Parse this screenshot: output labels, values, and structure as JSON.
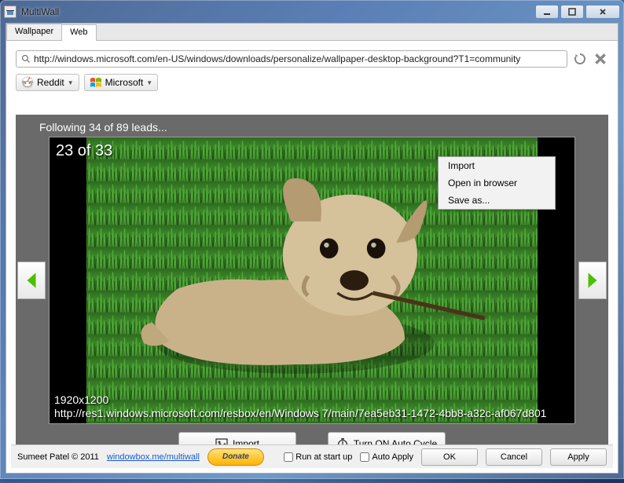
{
  "app_title": "MultiWall",
  "tabs": {
    "wallpaper": "Wallpaper",
    "web": "Web"
  },
  "url": "http://windows.microsoft.com/en-US/windows/downloads/personalize/wallpaper-desktop-background?T1=community",
  "sources": {
    "reddit": "Reddit",
    "microsoft": "Microsoft"
  },
  "following_text": "Following 34 of 89 leads...",
  "image_counter": "23 of 33",
  "resolution": "1920x1200",
  "image_source_url": "http://res1.windows.microsoft.com/resbox/en/Windows  7/main/7ea5eb31-1472-4bb8-a32c-af067d801",
  "context_menu": {
    "import": "Import",
    "open": "Open in browser",
    "save": "Save as..."
  },
  "viewer_buttons": {
    "import": "Import",
    "autocycle": "Turn ON Auto Cycle"
  },
  "footer": {
    "copyright": "Sumeet Patel © 2011",
    "link": "windowbox.me/multiwall",
    "donate": "Donate",
    "run_startup": "Run at start up",
    "auto_apply": "Auto Apply",
    "ok": "OK",
    "cancel": "Cancel",
    "apply": "Apply"
  }
}
